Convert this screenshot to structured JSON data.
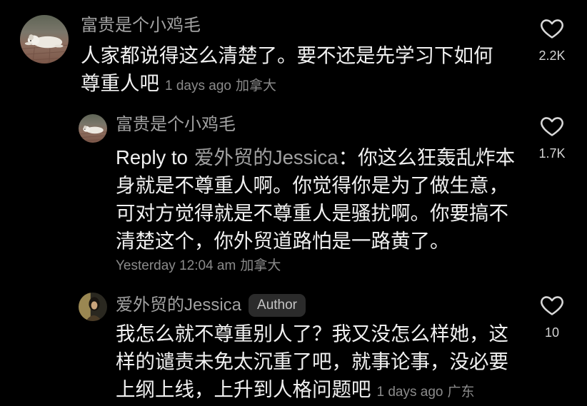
{
  "colors": {
    "background": "#000000",
    "text": "#f1f1f1",
    "username": "#a2a2a2",
    "meta": "#8b8b8b",
    "badge_bg": "#2b2b2b",
    "badge_text": "#c4c4c4",
    "like_count": "#d4d4d4",
    "icon": "#d8d8d8"
  },
  "icons": {
    "like": "heart-outline-icon"
  },
  "comments": [
    {
      "username": "富贵是个小鸡毛",
      "text_lines": [
        "人家都说得这么清楚了。要不还是先学习下如何",
        "尊重人吧"
      ],
      "time": "1 days ago",
      "location": "加拿大",
      "likes": "2.2K",
      "replies": [
        {
          "username": "富贵是个小鸡毛",
          "reply_to": {
            "label": "Reply to",
            "target": "爱外贸的Jessica"
          },
          "text_lines": [
            "：你这么狂轰乱炸本",
            "身就是不尊重人啊。你觉得你是为了做生意，",
            "可对方觉得就是不尊重人是骚扰啊。你要搞不",
            "清楚这个，你外贸道路怕是一路黄了。"
          ],
          "time": "Yesterday 12:04 am",
          "location": "加拿大",
          "likes": "1.7K"
        },
        {
          "username": "爱外贸的Jessica",
          "badge": "Author",
          "text_lines": [
            "我怎么就不尊重别人了？我又没怎么样她，这",
            "样的谴责未免太沉重了吧，就事论事，没必要",
            "上纲上线，上升到人格问题吧"
          ],
          "time": "1 days ago",
          "location": "广东",
          "likes": "10"
        }
      ]
    }
  ]
}
